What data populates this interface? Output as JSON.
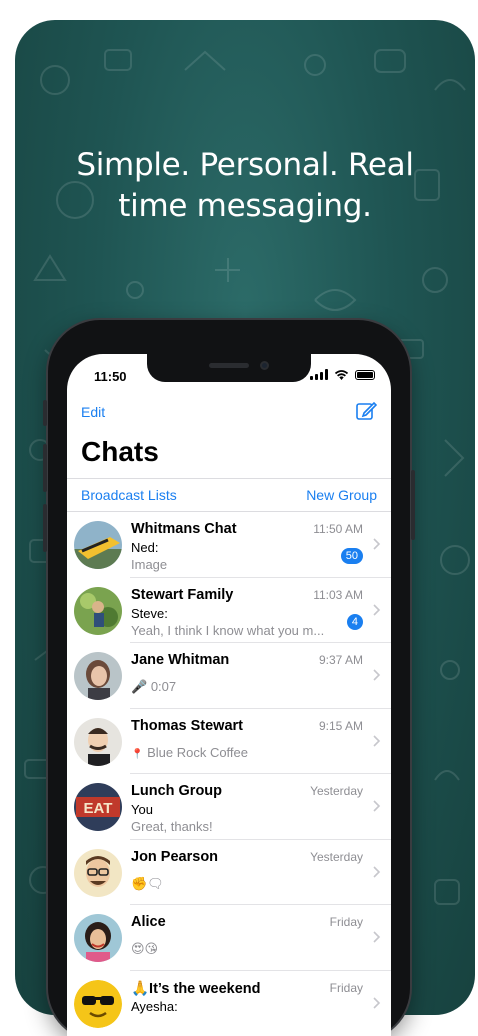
{
  "headline": {
    "line1": "Simple. Personal. Real",
    "line2": "time messaging."
  },
  "status": {
    "time": "11:50"
  },
  "nav": {
    "edit": "Edit",
    "compose_icon": "compose-icon",
    "title": "Chats"
  },
  "links": {
    "broadcast": "Broadcast Lists",
    "new_group": "New Group"
  },
  "colors": {
    "accent": "#1a7ff0",
    "background": "#1f5553",
    "badge": "#1a7ff0",
    "voice": "#4cd964"
  },
  "chats": [
    {
      "name": "Whitmans Chat",
      "time": "11:50 AM",
      "sender": "Ned:",
      "preview": "Image",
      "badge": "50"
    },
    {
      "name": "Stewart Family",
      "time": "11:03 AM",
      "sender": "Steve:",
      "preview": "Yeah, I think I know what you m...",
      "badge": "4"
    },
    {
      "name": "Jane Whitman",
      "time": "9:37 AM",
      "preview_icon": "🎤",
      "preview": "0:07"
    },
    {
      "name": "Thomas Stewart",
      "time": "9:15 AM",
      "preview_icon": "📍",
      "preview": "Blue Rock Coffee"
    },
    {
      "name": "Lunch Group",
      "time": "Yesterday",
      "sender": "You",
      "preview": "Great, thanks!"
    },
    {
      "name": "Jon Pearson",
      "time": "Yesterday",
      "preview": "✊🗨"
    },
    {
      "name": "Alice",
      "time": "Friday",
      "preview": "😍😘"
    },
    {
      "name": "🙏It’s the weekend",
      "time": "Friday",
      "sender": "Ayesha:"
    }
  ]
}
